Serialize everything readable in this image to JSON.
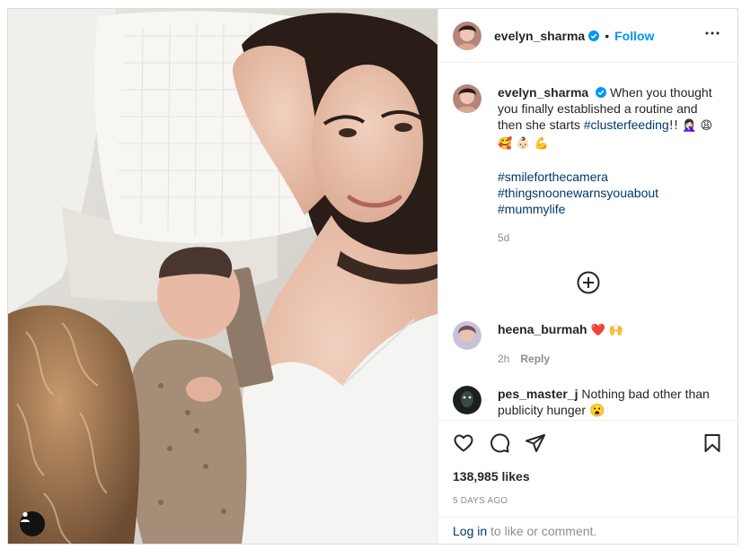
{
  "post": {
    "author": "evelyn_sharma",
    "dot": "•",
    "follow_label": "Follow",
    "more_icon": "more-options-icon"
  },
  "caption": {
    "author": "evelyn_sharma",
    "text_before": "When you thought you finally established a routine and then she starts ",
    "tag_inline": "#clusterfeeding",
    "text_after": "!! 🤦🏻‍♀️ 😩 🥰 👶🏻 💪",
    "hashtags": [
      "#smileforthecamera",
      "#thingsnoonewarnsyouabout",
      "#mummylife"
    ],
    "age": "5d"
  },
  "comments": [
    {
      "author": "heena_burmah",
      "text": "❤️ 🙌",
      "age": "2h",
      "reply_label": "Reply"
    },
    {
      "author": "pes_master_j",
      "text": "Nothing bad other than publicity hunger 😮"
    }
  ],
  "actions": {
    "like_icon": "heart-icon",
    "comment_icon": "comment-icon",
    "share_icon": "share-icon",
    "save_icon": "bookmark-icon"
  },
  "likes": "138,985 likes",
  "date": "5 DAYS AGO",
  "login": {
    "link": "Log in",
    "rest": " to like or comment."
  },
  "colors": {
    "accent": "#0095f6",
    "link": "#00376b",
    "muted": "#8e8e8e",
    "heart": "#ed4956"
  }
}
